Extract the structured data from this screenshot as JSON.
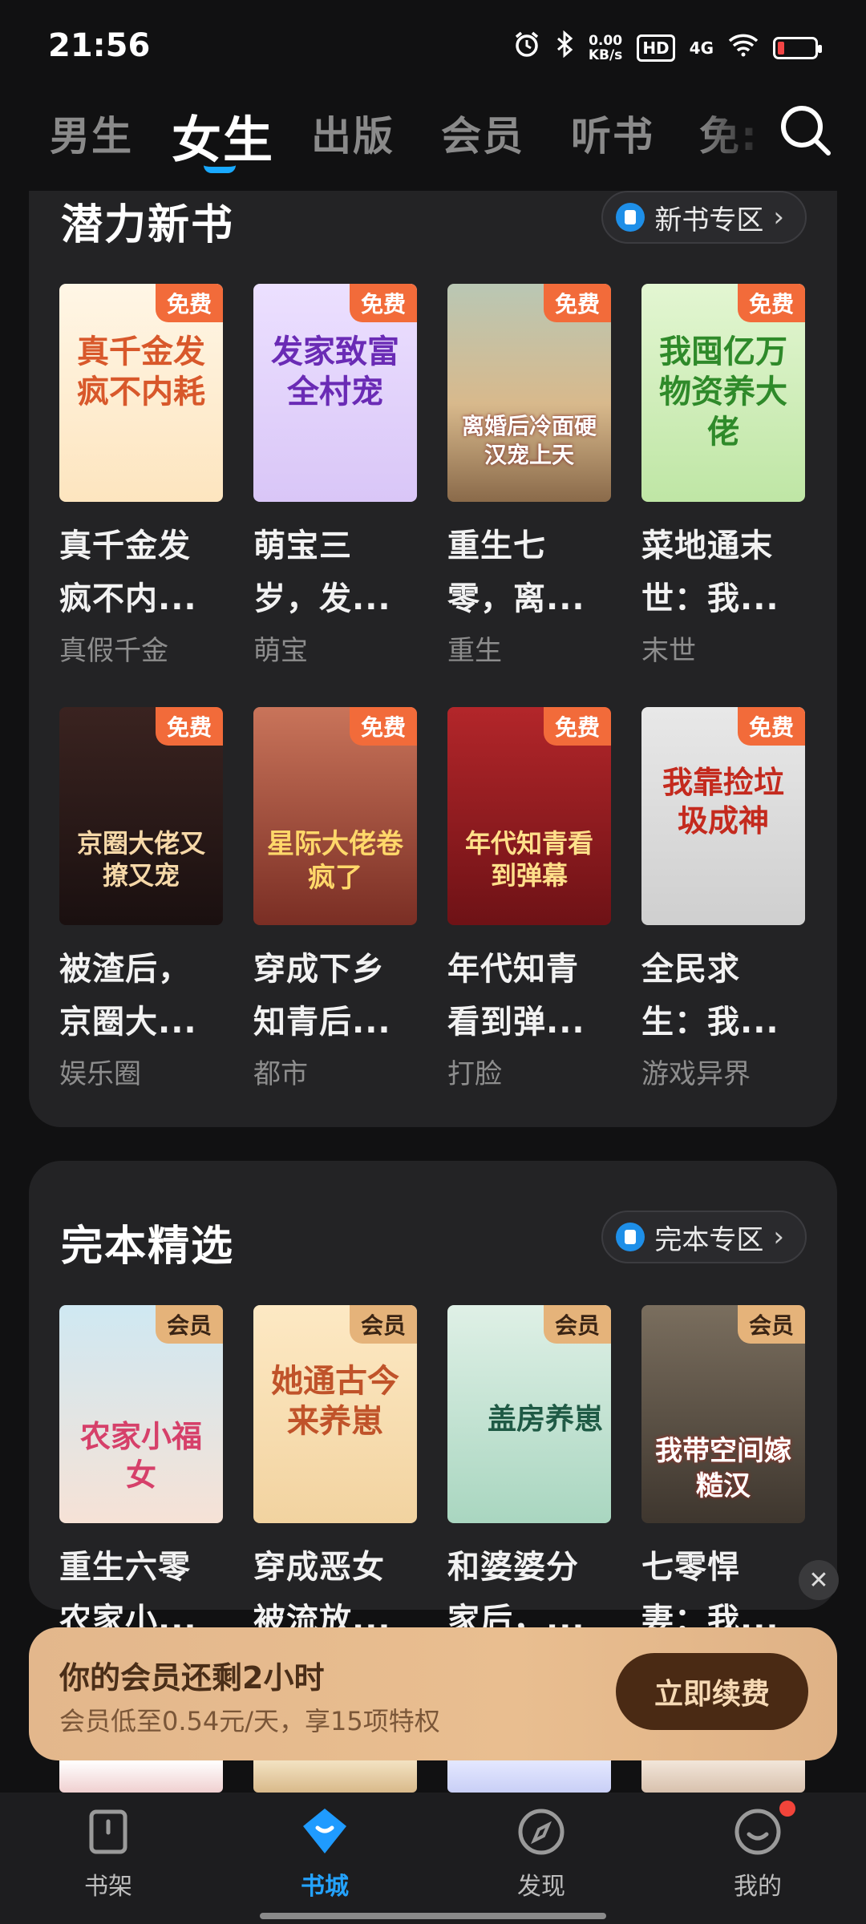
{
  "status_bar": {
    "time": "21:56",
    "net_speed_value": "0.00",
    "net_speed_unit": "KB/s",
    "hd_label": "HD",
    "signal_label": "4G",
    "icons": [
      "alarm-icon",
      "bluetooth-icon",
      "wifi-icon",
      "battery-icon"
    ],
    "battery_level": 0.1
  },
  "tabs": [
    {
      "label": "男生",
      "active": false
    },
    {
      "label": "女生",
      "active": true
    },
    {
      "label": "出版",
      "active": false
    },
    {
      "label": "会员",
      "active": false
    },
    {
      "label": "听书",
      "active": false
    },
    {
      "label": "免:",
      "active": false
    }
  ],
  "section1": {
    "title": "潜力新书",
    "zone_label": "新书专区",
    "books": [
      {
        "title_line1": "真千金发",
        "title_line2": "疯不内...",
        "tag": "真假千金",
        "badge": "免费",
        "cover_text": "真千金发疯不内耗"
      },
      {
        "title_line1": "萌宝三",
        "title_line2": "岁，发...",
        "tag": "萌宝",
        "badge": "免费",
        "cover_text": "发家致富全村宠"
      },
      {
        "title_line1": "重生七",
        "title_line2": "零，离...",
        "tag": "重生",
        "badge": "免费",
        "cover_text": "离婚后冷面硬汉宠上天"
      },
      {
        "title_line1": "菜地通末",
        "title_line2": "世：我...",
        "tag": "末世",
        "badge": "免费",
        "cover_text": "我囤亿万物资养大佬"
      },
      {
        "title_line1": "被渣后，",
        "title_line2": "京圈大...",
        "tag": "娱乐圈",
        "badge": "免费",
        "cover_text": "京圈大佬又撩又宠"
      },
      {
        "title_line1": "穿成下乡",
        "title_line2": "知青后...",
        "tag": "都市",
        "badge": "免费",
        "cover_text": "星际大佬卷疯了"
      },
      {
        "title_line1": "年代知青",
        "title_line2": "看到弹...",
        "tag": "打脸",
        "badge": "免费",
        "cover_text": "年代知青看到弹幕"
      },
      {
        "title_line1": "全民求",
        "title_line2": "生：我...",
        "tag": "游戏异界",
        "badge": "免费",
        "cover_text": "我靠捡垃圾成神"
      }
    ]
  },
  "section2": {
    "title": "完本精选",
    "zone_label": "完本专区",
    "books": [
      {
        "title_line1": "重生六零",
        "title_line2": "农家小...",
        "badge": "会员",
        "cover_text": "农家小福女"
      },
      {
        "title_line1": "穿成恶女",
        "title_line2": "被流放...",
        "badge": "会员",
        "cover_text": "她通古今来养崽"
      },
      {
        "title_line1": "和婆婆分",
        "title_line2": "家后，...",
        "badge": "会员",
        "cover_text": "盖房养崽"
      },
      {
        "title_line1": "七零悍",
        "title_line2": "妻：我...",
        "badge": "会员",
        "cover_text": "我带空间嫁糙汉"
      }
    ]
  },
  "vip_banner": {
    "main": "你的会员还剩2小时",
    "sub": "会员低至0.54元/天，享15项特权",
    "button": "立即续费"
  },
  "bottom_nav": [
    {
      "label": "书架",
      "icon": "bookshelf-icon",
      "active": false
    },
    {
      "label": "书城",
      "icon": "bookstore-icon",
      "active": true
    },
    {
      "label": "发现",
      "icon": "compass-icon",
      "active": false
    },
    {
      "label": "我的",
      "icon": "profile-icon",
      "active": false
    }
  ]
}
